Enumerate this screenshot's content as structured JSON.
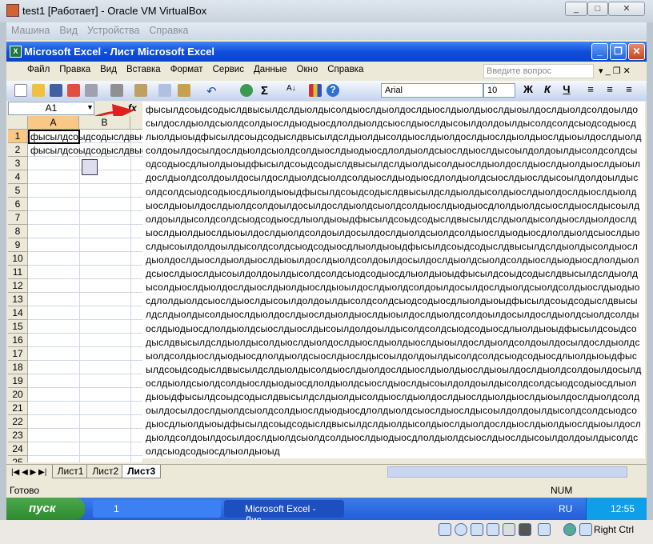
{
  "vbox": {
    "title": "test1 [Работает] - Oracle VM VirtualBox",
    "menu": [
      "Машина",
      "Вид",
      "Устройства",
      "Справка"
    ],
    "host_key": "Right Ctrl"
  },
  "excel": {
    "title": "Microsoft Excel - Лист Microsoft Excel",
    "menu": [
      "Файл",
      "Правка",
      "Вид",
      "Вставка",
      "Формат",
      "Сервис",
      "Данные",
      "Окно",
      "Справка"
    ],
    "ask_placeholder": "Введите вопрос",
    "font": "Arial",
    "font_size": "10",
    "bold": "Ж",
    "italic": "К",
    "underline": "Ч",
    "name_box": "A1",
    "fx": "fx",
    "columns": [
      "A",
      "B"
    ],
    "rows": [
      "1",
      "2",
      "3",
      "4",
      "5",
      "6",
      "7",
      "8",
      "9",
      "10",
      "11",
      "12",
      "13",
      "14",
      "15",
      "16",
      "17",
      "18",
      "19",
      "20",
      "21",
      "22",
      "23",
      "24",
      "25"
    ],
    "cell_a1": "фысылдсоыдсодыслдвысылдслдыолдысолдыослд",
    "cell_a2": "фысылдсоыдсодыслдвысылдслдыолдысолдыослд",
    "formula_unit": "фысылдсоыдсодыслдвысылдслдыолдысолдыослдыолдослдыослдыолдыослдыоылдослдыолдсолдоылдосылдослдыолдсыолдсолдыослдыодыосдлолдыолдсыослдыослдысоылдолдоылдысолдсолдсыодсодыосдлыолдыоыд",
    "formula_repeat": 12,
    "sheets": [
      "Лист1",
      "Лист2",
      "Лист3"
    ],
    "active_sheet": "Лист3",
    "status": "Готово",
    "num": "NUM"
  },
  "taskbar": {
    "start": "пуск",
    "tasks": [
      "1",
      "Microsoft Excel - Лис..."
    ],
    "lang": "RU",
    "clock": "12:55"
  }
}
